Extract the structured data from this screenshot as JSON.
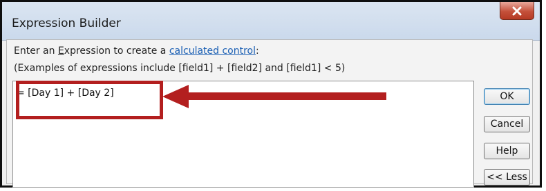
{
  "window": {
    "title": "Expression Builder"
  },
  "instructions": {
    "line1_before": "Enter an ",
    "line1_underlined": "E",
    "line1_middle": "xpression to create a ",
    "line1_link": "calculated control",
    "line1_after": ":",
    "line2": "(Examples of expressions include [field1] + [field2] and [field1] < 5)"
  },
  "expression": {
    "value": "= [Day 1] + [Day 2]"
  },
  "buttons": {
    "ok": "OK",
    "cancel": "Cancel",
    "help": "Help",
    "less": "<< Less"
  },
  "icons": {
    "close": "close-icon",
    "arrow": "arrow-left-icon"
  },
  "colors": {
    "annotation_red": "#b31f1f",
    "link_blue": "#1a5fb4",
    "close_button": "#c4503a"
  }
}
